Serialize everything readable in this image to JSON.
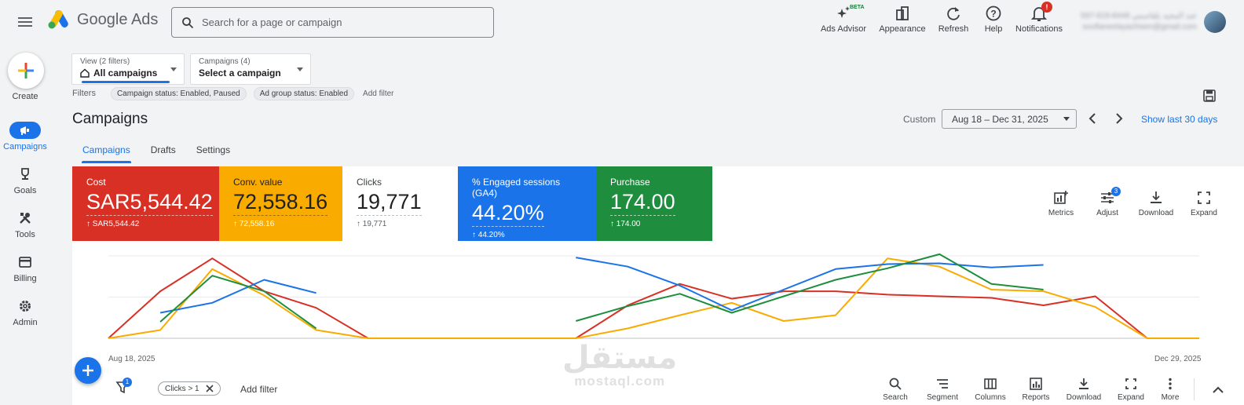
{
  "app": {
    "name": "Google Ads",
    "search_placeholder": "Search for a page or campaign"
  },
  "top_actions": [
    {
      "label": "Ads Advisor",
      "icon": "sparkle-icon",
      "badge": "BETA"
    },
    {
      "label": "Appearance",
      "icon": "appearance-icon"
    },
    {
      "label": "Refresh",
      "icon": "refresh-icon"
    },
    {
      "label": "Help",
      "icon": "help-icon"
    },
    {
      "label": "Notifications",
      "icon": "bell-icon",
      "badge": "!"
    }
  ],
  "account": {
    "line1": "597-919-8448 عبد المجيد بلقاسمي",
    "line2": "soufianeelayachiwm@gmail.com"
  },
  "rail": {
    "create": "Create",
    "items": [
      {
        "label": "Campaigns",
        "icon": "megaphone-icon",
        "active": true
      },
      {
        "label": "Goals",
        "icon": "trophy-icon"
      },
      {
        "label": "Tools",
        "icon": "tools-icon"
      },
      {
        "label": "Billing",
        "icon": "card-icon"
      },
      {
        "label": "Admin",
        "icon": "gear-icon"
      }
    ]
  },
  "view_selector": {
    "small": "View (2 filters)",
    "value": "All campaigns"
  },
  "campaign_selector": {
    "small": "Campaigns (4)",
    "value": "Select a campaign"
  },
  "filters": {
    "label": "Filters",
    "chips": [
      "Campaign status: Enabled, Paused",
      "Ad group status: Enabled"
    ],
    "add": "Add filter"
  },
  "page_title": "Campaigns",
  "date": {
    "custom_label": "Custom",
    "range": "Aug 18 – Dec 31, 2025",
    "show_last": "Show last 30 days"
  },
  "tabs": [
    "Campaigns",
    "Drafts",
    "Settings"
  ],
  "metrics": [
    {
      "name": "Cost",
      "value": "SAR5,544.42",
      "compare": "SAR5,544.42",
      "color": "#d93025"
    },
    {
      "name": "Conv. value",
      "value": "72,558.16",
      "compare": "72,558.16",
      "color": "#f9ab00"
    },
    {
      "name": "Clicks",
      "value": "19,771",
      "compare": "19,771",
      "color": "#ffffff"
    },
    {
      "name": "% Engaged sessions (GA4)",
      "value": "44.20%",
      "compare": "44.20%",
      "color": "#1a73e8"
    },
    {
      "name": "Purchase",
      "value": "174.00",
      "compare": "174.00",
      "color": "#1e8e3e"
    }
  ],
  "chart_tools": [
    {
      "label": "Metrics",
      "icon": "metrics-icon"
    },
    {
      "label": "Adjust",
      "icon": "adjust-icon",
      "badge": "3"
    },
    {
      "label": "Download",
      "icon": "download-icon"
    },
    {
      "label": "Expand",
      "icon": "expand-icon"
    }
  ],
  "chart_data": {
    "type": "line",
    "x_start_label": "Aug 18, 2025",
    "x_end_label": "Dec 29, 2025",
    "grid": true,
    "series": [
      {
        "name": "Cost",
        "color": "#d93025",
        "values": [
          0,
          57,
          97,
          57,
          37,
          0,
          0,
          0,
          0,
          0,
          40,
          66,
          48,
          57,
          57,
          53,
          51,
          49,
          40,
          51,
          0,
          0
        ]
      },
      {
        "name": "Conv. value",
        "color": "#f9ab00",
        "values": [
          0,
          10,
          84,
          52,
          10,
          0,
          0,
          0,
          0,
          0,
          12,
          28,
          43,
          21,
          28,
          97,
          87,
          59,
          57,
          38,
          0,
          0
        ]
      },
      {
        "name": "% Engaged sessions (GA4)",
        "color": "#1a73e8",
        "values": [
          null,
          31,
          43,
          71,
          55,
          null,
          null,
          null,
          null,
          98,
          87,
          64,
          34,
          59,
          84,
          90,
          91,
          86,
          89,
          null,
          null,
          null
        ]
      },
      {
        "name": "Purchase",
        "color": "#1e8e3e",
        "values": [
          null,
          20,
          76,
          57,
          12,
          null,
          null,
          null,
          null,
          21,
          39,
          54,
          31,
          51,
          71,
          85,
          102,
          66,
          59,
          null,
          null,
          null
        ]
      }
    ]
  },
  "bottom": {
    "filter_badge": "1",
    "chip": "Clicks > 1",
    "add_filter": "Add filter",
    "tools": [
      {
        "label": "Search",
        "icon": "search-icon"
      },
      {
        "label": "Segment",
        "icon": "segment-icon"
      },
      {
        "label": "Columns",
        "icon": "columns-icon"
      },
      {
        "label": "Reports",
        "icon": "reports-icon"
      },
      {
        "label": "Download",
        "icon": "download-icon"
      },
      {
        "label": "Expand",
        "icon": "expand-icon"
      },
      {
        "label": "More",
        "icon": "more-icon"
      }
    ]
  },
  "watermark": {
    "arabic": "مستقل",
    "latin": "mostaql.com"
  }
}
